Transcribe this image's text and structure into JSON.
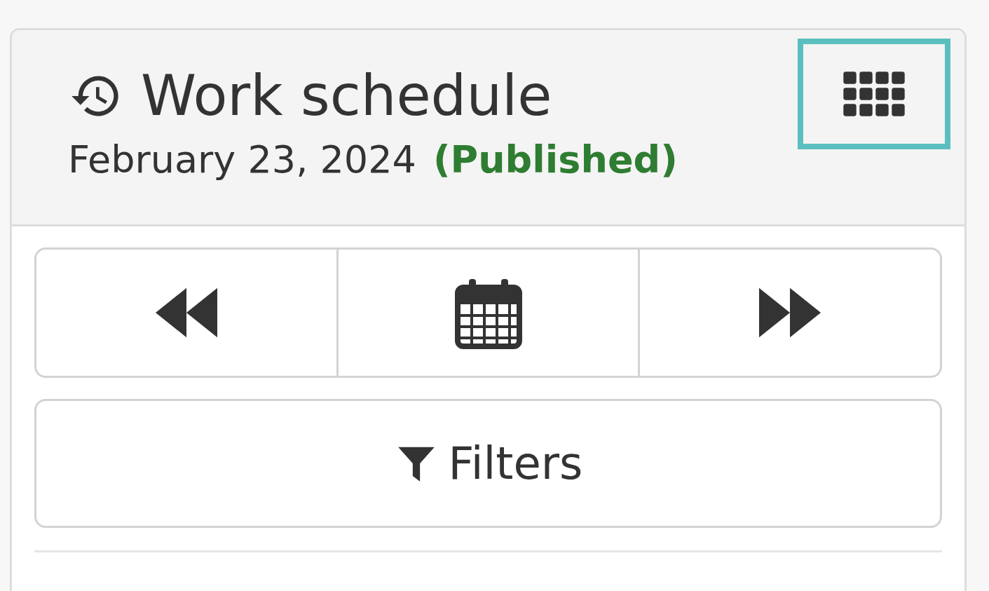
{
  "header": {
    "title": "Work schedule",
    "date": "February 23, 2024",
    "status": {
      "label": "(Published)",
      "kind": "published"
    },
    "apps_button": {
      "focused": true
    }
  },
  "nav_buttons": [
    {
      "kind": "previous"
    },
    {
      "kind": "calendar"
    },
    {
      "kind": "next"
    }
  ],
  "filters_button": {
    "label": "Filters"
  }
}
